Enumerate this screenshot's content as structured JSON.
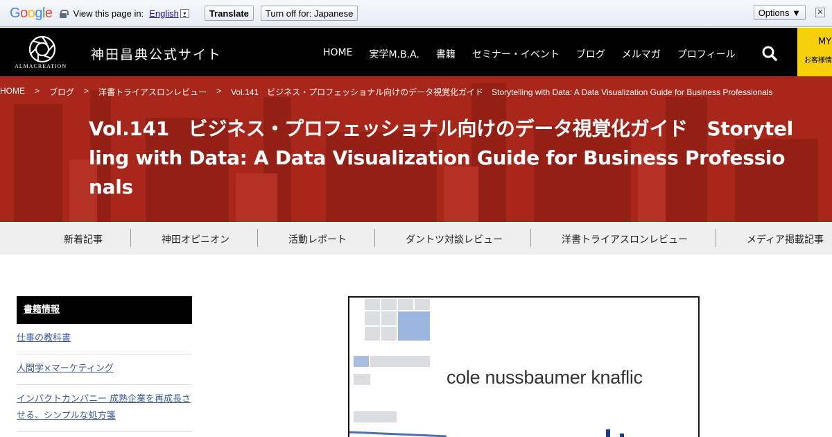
{
  "translate_bar": {
    "logo_letters": [
      "G",
      "o",
      "o",
      "g",
      "l",
      "e"
    ],
    "view_text": "View this page in:",
    "language": "English",
    "language_arrow": "▾",
    "translate_button": "Translate",
    "turn_off_button": "Turn off for: Japanese",
    "options_button": "Options ▼",
    "close_label": "✕"
  },
  "header": {
    "logo_text": "ALMACREATION",
    "site_title": "神田昌典公式サイト",
    "nav": [
      "HOME",
      "実学M.B.A.",
      "書籍",
      "セミナー・イベント",
      "ブログ",
      "メルマガ",
      "プロフィール"
    ],
    "my_label": "MY",
    "my_sub": "お客様情報"
  },
  "hero": {
    "breadcrumb": [
      "HOME",
      "ブログ",
      "洋書トライアスロンレビュー",
      "Vol.141　ビジネス・プロフェッショナル向けのデータ視覚化ガイド　Storytelling with Data: A Data Visualization Guide for Business Professionals"
    ],
    "breadcrumb_sep": ">",
    "title": "Vol.141　ビジネス・プロフェッショナル向けのデータ視覚化ガイド　Storytelling with Data: A Data Visualization Guide for Business Professionals"
  },
  "categories": [
    "新着記事",
    "神田オピニオン",
    "活動レポート",
    "ダントツ対談レビュー",
    "洋書トライアスロンレビュー",
    "メディア掲載記事"
  ],
  "sidebar": {
    "heading": "書籍情報",
    "links": [
      "仕事の教科書",
      "人間学×マーケティング",
      "インパクトカンパニー 成熟企業を再成長させる、シンプルな処方箋"
    ]
  },
  "cover": {
    "author": "cole nussbaumer knaflic"
  },
  "colors": {
    "hero_red": "#a8261a",
    "header_black": "#000000",
    "my_yellow": "#f6d10b",
    "link_blue": "#3a5aa0"
  }
}
